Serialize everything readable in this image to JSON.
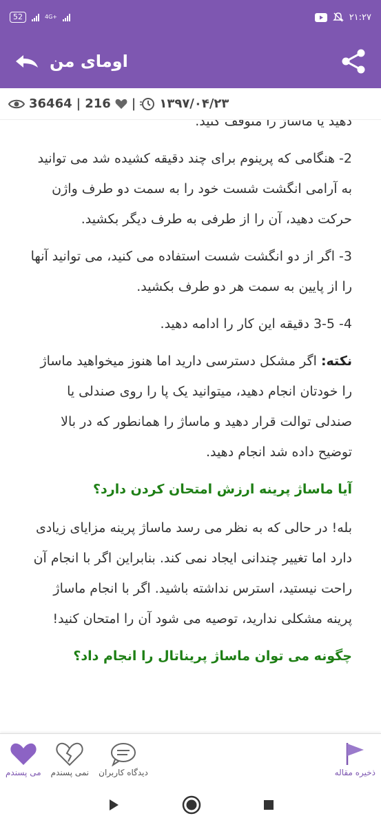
{
  "status_bar": {
    "battery": "52",
    "network": "4G+",
    "time": "۲۱:۲۷"
  },
  "header": {
    "title": "اومای من"
  },
  "meta": {
    "views": "36464",
    "likes": "216",
    "date": "۱۳۹۷/۰۴/۲۳",
    "separator": "|"
  },
  "article": {
    "partial_line": "دهید یا ماساژ را متوقف کنید.",
    "step2": "2- هنگامی که پرینوم برای چند دقیقه کشیده شد می توانید به آرامی انگشت شست خود را به سمت دو طرف واژن حرکت دهید، آن را از طرفی به طرف دیگر بکشید.",
    "step3": "3- اگر از دو انگشت شست استفاده می کنید، می توانید آنها را از پایین به سمت هر دو طرف بکشید.",
    "step4": "4- 3-5 دقیقه این کار را ادامه دهید.",
    "note_label": "نکته:",
    "note_text": " اگر مشکل دسترسی دارید اما هنوز میخواهید ماساژ را خودتان انجام دهید، میتوانید یک پا را روی صندلی یا صندلی توالت قرار دهید و ماساژ را همانطور که در بالا توضیح داده شد انجام دهید.",
    "heading1": "آیا ماساژ پرینه ارزش امتحان کردن دارد؟",
    "para1": "بله! در حالی که به نظر می رسد ماساژ پرینه مزایای زیادی دارد اما تغییر چندانی ایجاد نمی کند. بنابراین اگر با انجام آن راحت نیستید، استرس نداشته باشید. اگر با انجام ماساژ پرینه مشکلی ندارید، توصیه می شود آن را امتحان کنید!",
    "heading2": "چگونه می توان ماساژ پریناتال را انجام داد؟"
  },
  "actions": {
    "like": "می پسندم",
    "dislike": "نمی پسندم",
    "comments": "دیدگاه کاربران",
    "save": "ذخیره مقاله"
  },
  "colors": {
    "primary": "#7e57b1",
    "heading": "#1e7f15"
  }
}
